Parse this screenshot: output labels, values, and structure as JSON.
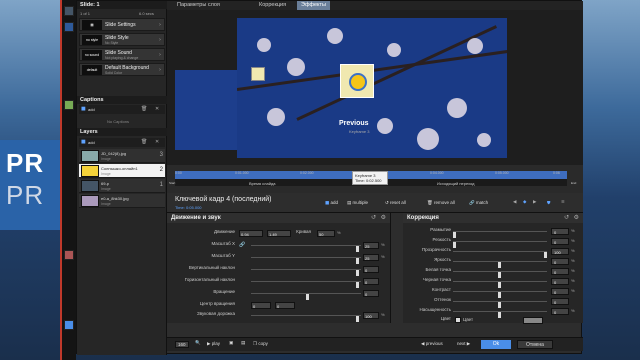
{
  "background": {
    "text1": "PR",
    "text2": "PR"
  },
  "sidebar": {
    "slide_header": "Slide: 1",
    "slide_counter": "1 of 1",
    "slide_time": "6.0 secs",
    "rows": [
      {
        "icon": "",
        "title": "Slide Settings",
        "sub": ""
      },
      {
        "icon": "no style",
        "title": "Slide Style",
        "sub": "No Style"
      },
      {
        "icon": "no sound",
        "title": "Slide Sound",
        "sub": "Not playing & change"
      },
      {
        "icon": "default",
        "title": "Default Background",
        "sub": "Solid Color"
      }
    ],
    "captions_header": "Captions",
    "captions_add": "add",
    "no_captions": "No Captions",
    "layers_header": "Layers",
    "layers_add": "add",
    "layers": [
      {
        "name": "JD_042(8).jpg",
        "sub": "Image",
        "num": "3"
      },
      {
        "name": "Солнышко-онлайн1",
        "sub": "Image",
        "num": "2"
      },
      {
        "name": "69-p",
        "sub": "Image",
        "num": "1"
      },
      {
        "name": "e0-a_8hk30.jpg",
        "sub": "Image",
        "num": ""
      }
    ]
  },
  "tabs": [
    "Параметры слоя",
    "Коррекция",
    "Эффекты"
  ],
  "preview": {
    "previous": "Previous",
    "prev_sub": "Keyframe 3"
  },
  "keyframe_popup": {
    "title": "Keyframe 3",
    "time": "Time: 0:02.500"
  },
  "timeline": {
    "ticks": [
      "0:00",
      "0:01.000",
      "0:02.000",
      "0:03.000",
      "0:04.000",
      "0:05.000",
      "0:06"
    ],
    "start": "Start",
    "end": "End",
    "slide_time": "Время слайда",
    "out_transition": "Исходящий переход"
  },
  "keyframe": {
    "title": "Ключевой кадр 4 (последний)",
    "time": "Time: 0:05.000",
    "buttons": [
      "add",
      "multiple",
      "reset all",
      "remove all",
      "match"
    ]
  },
  "motion_panel": {
    "title": "Движение и звук",
    "rows": [
      {
        "label": "Движение",
        "v1": "0.94",
        "v2": "1.49",
        "extra": "Кривая",
        "v3": "50"
      },
      {
        "label": "Масштаб X",
        "v1": "",
        "v2": "25"
      },
      {
        "label": "Масштаб Y",
        "v1": "",
        "v2": "25"
      },
      {
        "label": "Вертикальный наклон",
        "v1": "",
        "v2": "0"
      },
      {
        "label": "Горизонтальный наклон",
        "v1": "",
        "v2": "0"
      },
      {
        "label": "Вращение",
        "v1": "",
        "v2": "0"
      },
      {
        "label": "Центр вращения",
        "v1": "0",
        "v2": "0"
      },
      {
        "label": "Звуковая дорожка",
        "v1": "",
        "v2": "100"
      }
    ]
  },
  "correction_panel": {
    "title": "Коррекция",
    "rows": [
      {
        "label": "Размытие",
        "value": "0"
      },
      {
        "label": "Резкость",
        "value": "0"
      },
      {
        "label": "Прозрачность",
        "value": "100"
      },
      {
        "label": "Яркость",
        "value": "0"
      },
      {
        "label": "Белая точка",
        "value": "0"
      },
      {
        "label": "Черная точка",
        "value": "0"
      },
      {
        "label": "Контраст",
        "value": "0"
      },
      {
        "label": "Оттенок",
        "value": "0"
      },
      {
        "label": "Насыщенность",
        "value": "0"
      }
    ],
    "color_label": "Цвет",
    "color_check": "Цвет"
  },
  "footer": {
    "page_num": "160",
    "play": "play",
    "copy": "copy",
    "previous": "previous",
    "next": "next",
    "ok": "Ok",
    "cancel": "Отмена"
  },
  "colors": {
    "accent": "#4a8ee8",
    "stage_blue": "#1a3a86"
  }
}
